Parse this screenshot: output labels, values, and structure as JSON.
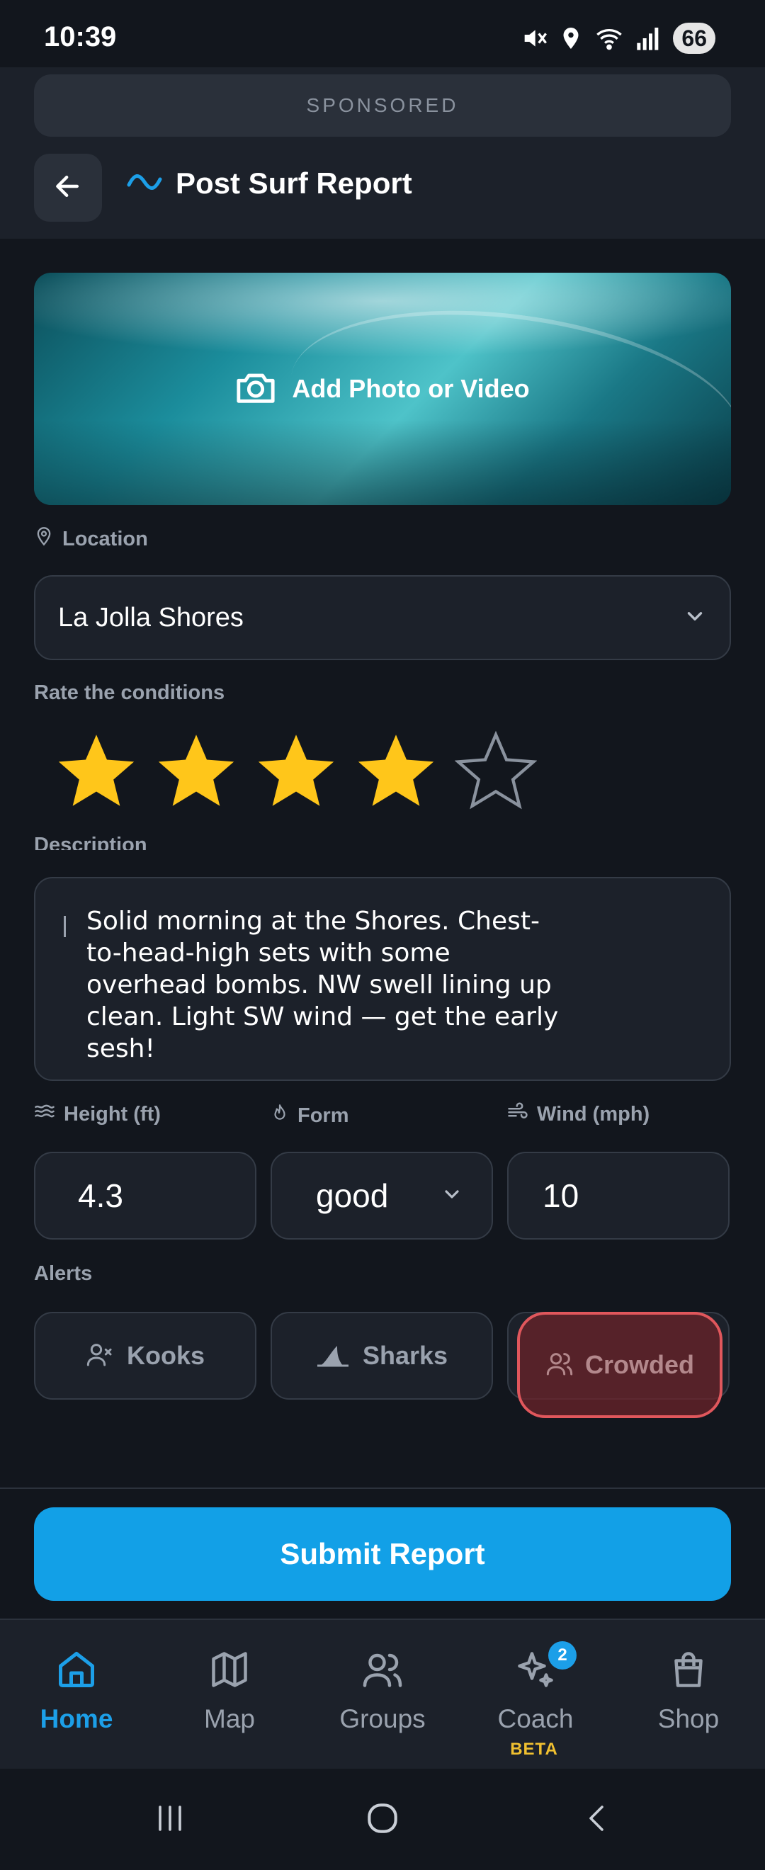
{
  "status_bar": {
    "time": "10:39",
    "battery": "66",
    "icons": [
      "mute-icon",
      "location-icon",
      "wifi-icon",
      "signal-icon",
      "battery-icon"
    ]
  },
  "ad": {
    "label": "SPONSORED"
  },
  "header": {
    "title": "Post Surf Report",
    "back_icon": "arrow-left-icon",
    "brand_icon": "wave-icon"
  },
  "media": {
    "cta_label": "Add Photo or Video",
    "icon": "camera-icon"
  },
  "location": {
    "label": "Location",
    "value": "La Jolla Shores",
    "icon": "map-pin-icon"
  },
  "rating": {
    "label": "Rate the conditions",
    "value": 4,
    "max": 5,
    "filled_color": "#ffc61a",
    "empty_color": "#8a929e"
  },
  "description": {
    "label": "Description",
    "value": "Solid morning at the Shores. Chest-to-head-high sets with some overhead bombs. NW swell lining up clean. Light SW wind — get the early sesh!"
  },
  "metrics": {
    "height": {
      "label": "Height (ft)",
      "value": "4.3",
      "icon": "waves-icon"
    },
    "form": {
      "label": "Form",
      "value": "good",
      "icon": "flame-icon"
    },
    "wind": {
      "label": "Wind (mph)",
      "value": "10",
      "icon": "wind-icon"
    }
  },
  "alerts": {
    "label": "Alerts",
    "items": [
      {
        "label": "Kooks",
        "icon": "user-x-icon",
        "active": false
      },
      {
        "label": "Sharks",
        "icon": "shark-fin-icon",
        "active": false
      },
      {
        "label": "Crowded",
        "icon": "users-icon",
        "active": true
      }
    ],
    "active_color": "#e0575c"
  },
  "submit": {
    "label": "Submit Report",
    "color": "#12a0e7"
  },
  "nav": {
    "items": [
      {
        "label": "Home",
        "icon": "home-icon",
        "active": true
      },
      {
        "label": "Map",
        "icon": "map-icon",
        "active": false
      },
      {
        "label": "Groups",
        "icon": "users-icon",
        "active": false
      },
      {
        "label": "Coach",
        "icon": "sparkles-icon",
        "active": false,
        "badge": "2",
        "tag": "BETA"
      },
      {
        "label": "Shop",
        "icon": "shopping-bag-icon",
        "active": false
      }
    ],
    "accent": "#1c9fe8"
  },
  "system_nav": [
    "recents-icon",
    "home-circle-icon",
    "back-chevron-icon"
  ]
}
